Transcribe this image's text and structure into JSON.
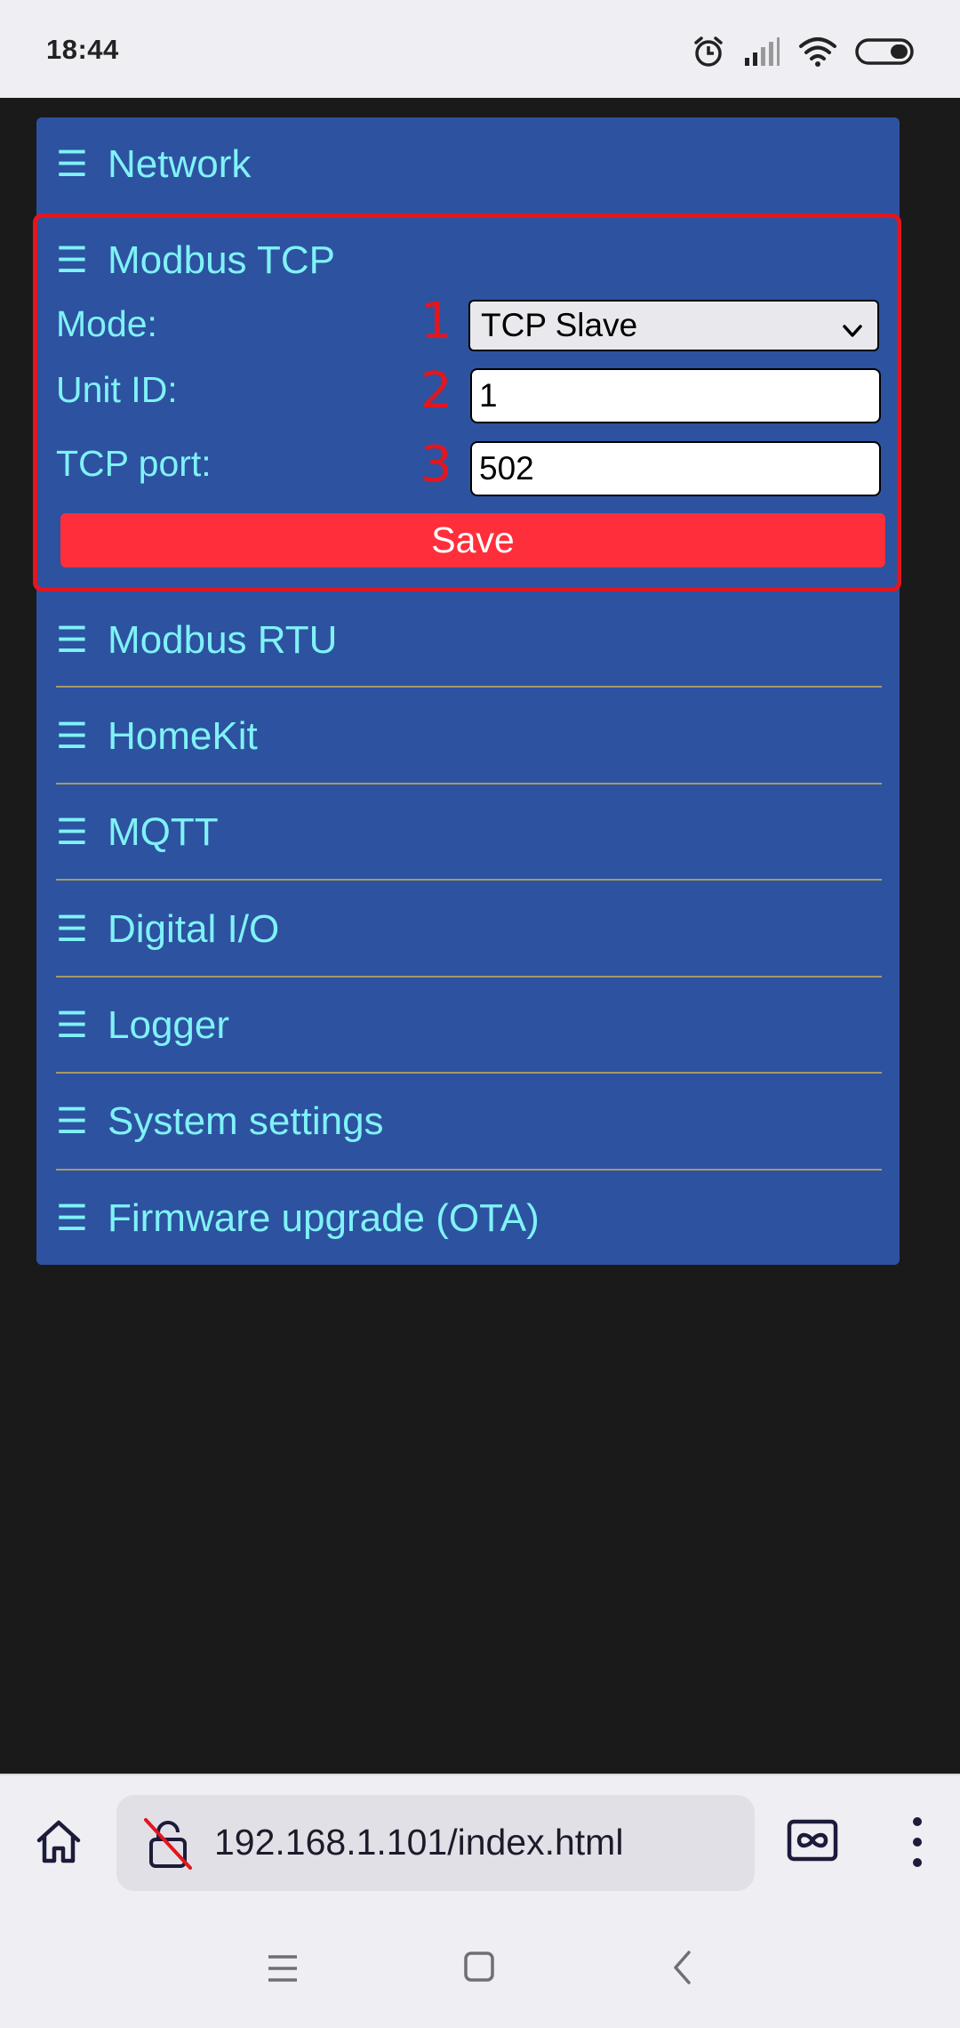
{
  "status_bar": {
    "time": "18:44",
    "icons": [
      "alarm-icon",
      "signal-icon",
      "wifi-icon",
      "battery-icon"
    ]
  },
  "menu": {
    "burger_glyph": "☰",
    "network": "Network",
    "modbus_tcp": "Modbus TCP",
    "modbus_rtu": "Modbus RTU",
    "homekit": "HomeKit",
    "mqtt": "MQTT",
    "digital_io": "Digital I/O",
    "logger": "Logger",
    "system_settings": "System settings",
    "firmware_upgrade": "Firmware upgrade (OTA)"
  },
  "modbus_tcp_form": {
    "mode_label": "Mode:",
    "mode_value": "TCP Slave",
    "unit_id_label": "Unit ID:",
    "unit_id_value": "1",
    "tcp_port_label": "TCP port:",
    "tcp_port_value": "502",
    "save_label": "Save",
    "step_1": "1",
    "step_2": "2",
    "step_3": "3"
  },
  "browser": {
    "url": "192.168.1.101/index.html"
  },
  "colors": {
    "panel": "#2d52a0",
    "menu_text": "#7ff2f7",
    "highlight": "#e3161e",
    "save_button": "#fe2f3a",
    "page_bg": "#1a1a1a"
  }
}
